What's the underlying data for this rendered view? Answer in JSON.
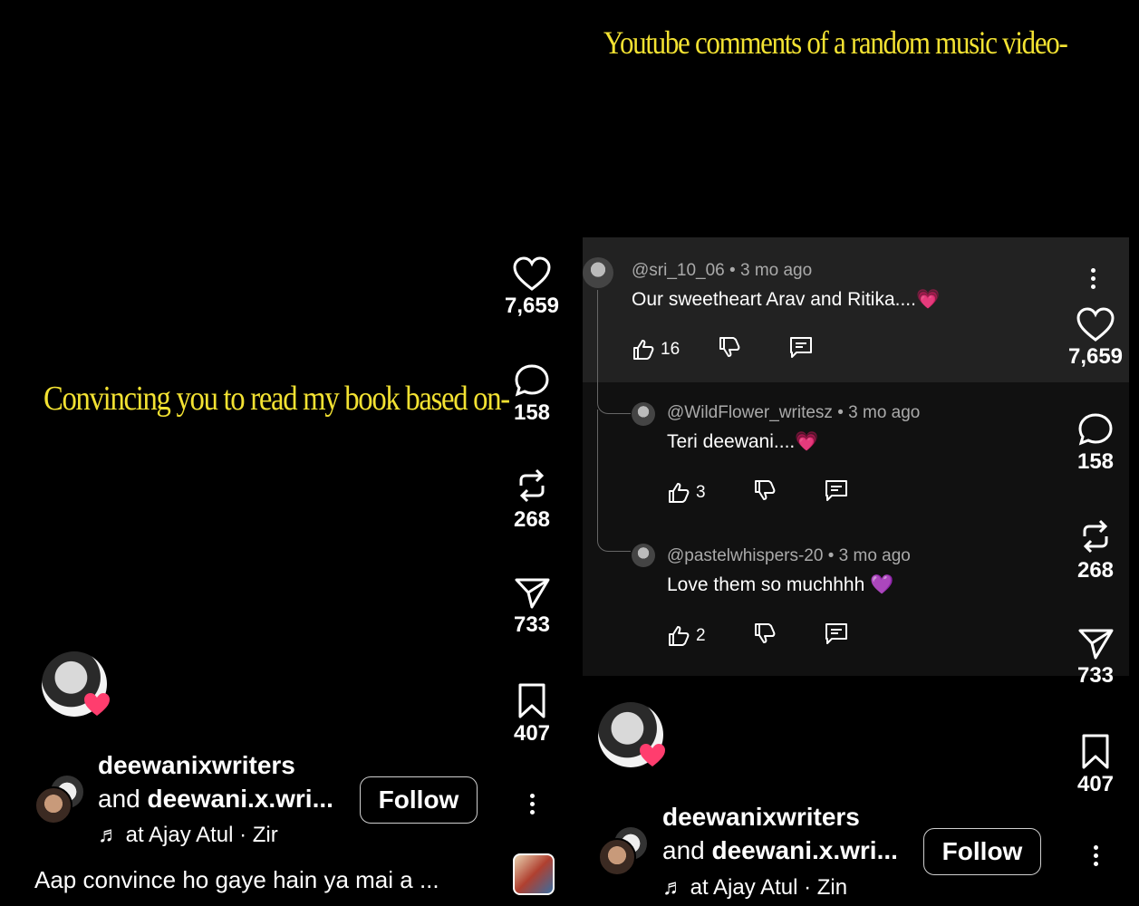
{
  "left": {
    "overlay_title": "Convincing you to read my book based on-",
    "rail": {
      "likes": "7,659",
      "comments": "158",
      "reposts": "268",
      "shares": "733",
      "saves": "407"
    },
    "user": {
      "name": "deewanixwriters",
      "collab_prefix": "and ",
      "collab": "deewani.x.wri...",
      "follow": "Follow"
    },
    "music": "at   Ajay Atul · Zir",
    "caption": "Aap convince ho gaye hain ya mai a ..."
  },
  "right": {
    "overlay_title": "Youtube comments of a random music video-",
    "comments": [
      {
        "author": "@sri_10_06",
        "age": "3 mo ago",
        "text": "Our sweetheart Arav and Ritika....",
        "emoji": "💗",
        "likes": "16"
      },
      {
        "author": "@WildFlower_writesz",
        "age": "3 mo ago",
        "text": "Teri deewani....",
        "emoji": "💗",
        "likes": "3"
      },
      {
        "author": "@pastelwhispers-20",
        "age": "3 mo ago",
        "text": "Love them so muchhhh",
        "emoji": "💜",
        "likes": "2"
      }
    ],
    "rail": {
      "likes": "7,659",
      "comments": "158",
      "reposts": "268",
      "shares": "733",
      "saves": "407"
    },
    "user": {
      "name": "deewanixwriters",
      "collab_prefix": "and ",
      "collab": "deewani.x.wri...",
      "follow": "Follow"
    },
    "music": "at   Ajay Atul · Zin",
    "meta_sep": " • "
  },
  "icons": {
    "like": "heart-icon",
    "comment": "comment-bubble-icon",
    "repost": "repost-arrows-icon",
    "share": "send-plane-icon",
    "save": "bookmark-icon",
    "more": "more-vertical-icon",
    "music": "music-note-icon",
    "thumb_up": "thumbs-up-icon",
    "thumb_down": "thumbs-down-icon",
    "reply": "reply-icon"
  },
  "colors": {
    "overlay_text": "#f3e232",
    "background": "#000000",
    "comment_bg": "#111111",
    "heart_badge": "#ff3d6e"
  }
}
